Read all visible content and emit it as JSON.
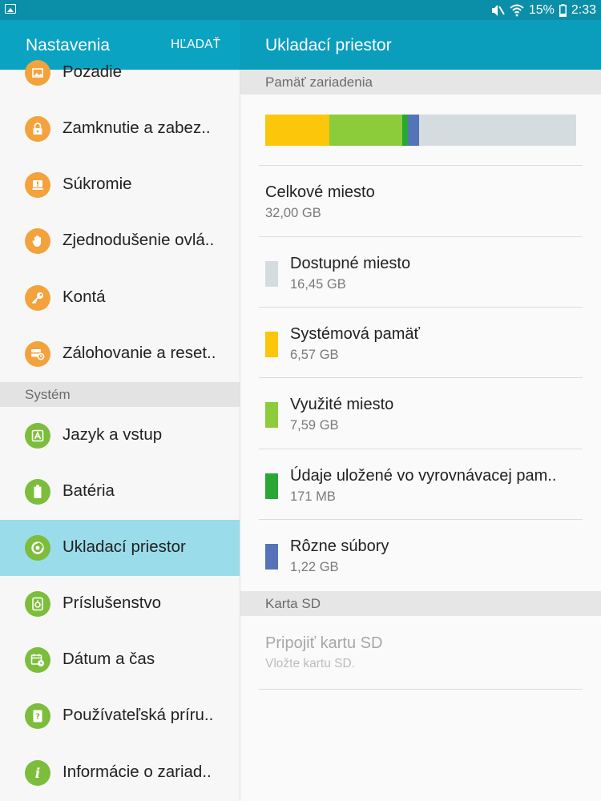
{
  "status_bar": {
    "battery_percent": "15%",
    "time": "2:33",
    "icons": [
      "gallery-icon",
      "mute-icon",
      "wifi-icon",
      "battery-icon"
    ]
  },
  "left_header": {
    "title": "Nastavenia",
    "search": "HĽADAŤ"
  },
  "right_header": {
    "title": "Ukladací priestor"
  },
  "left_list": {
    "items": [
      {
        "label": "Pozadie",
        "icon": "wallpaper-icon",
        "color": "#f3a23c"
      },
      {
        "label": "Zamknutie a zabez..",
        "icon": "lock-icon",
        "color": "#f3a23c"
      },
      {
        "label": "Súkromie",
        "icon": "privacy-icon",
        "color": "#f3a23c"
      },
      {
        "label": "Zjednodušenie ovlá..",
        "icon": "hand-icon",
        "color": "#f3a23c"
      },
      {
        "label": "Kontá",
        "icon": "key-icon",
        "color": "#f3a23c"
      },
      {
        "label": "Zálohovanie a reset..",
        "icon": "backup-icon",
        "color": "#f3a23c"
      }
    ],
    "section": "Systém",
    "system_items": [
      {
        "label": "Jazyk a vstup",
        "icon": "language-icon",
        "color": "#7cbd3b"
      },
      {
        "label": "Batéria",
        "icon": "battery-icon",
        "color": "#7cbd3b"
      },
      {
        "label": "Ukladací priestor",
        "icon": "storage-icon",
        "color": "#7cbd3b",
        "active": true
      },
      {
        "label": "Príslušenstvo",
        "icon": "accessory-icon",
        "color": "#7cbd3b"
      },
      {
        "label": "Dátum a čas",
        "icon": "calendar-icon",
        "color": "#7cbd3b"
      },
      {
        "label": "Používateľská príru..",
        "icon": "manual-icon",
        "color": "#7cbd3b"
      },
      {
        "label": "Informácie o zariad..",
        "icon": "info-icon",
        "color": "#7cbd3b"
      }
    ]
  },
  "storage": {
    "section_device": "Pamäť zariadenia",
    "total": {
      "title": "Celkové miesto",
      "value": "32,00 GB"
    },
    "items": [
      {
        "title": "Dostupné miesto",
        "value": "16,45 GB",
        "color": "#d5dcdf"
      },
      {
        "title": "Systémová pamäť",
        "value": "6,57 GB",
        "color": "#fcc60b"
      },
      {
        "title": "Využité miesto",
        "value": "7,59 GB",
        "color": "#8ccc3a"
      },
      {
        "title": "Údaje uložené vo vyrovnávacej pam..",
        "value": "171 MB",
        "color": "#2aa635"
      },
      {
        "title": "Rôzne súbory",
        "value": "1,22 GB",
        "color": "#5573b8"
      }
    ],
    "usage_fractions": {
      "system": 0.205,
      "used": 0.237,
      "cache": 0.016,
      "misc": 0.038,
      "available": 0.504
    },
    "section_sd": "Karta SD",
    "sd": {
      "title": "Pripojiť kartu SD",
      "subtitle": "Vložte kartu SD."
    }
  }
}
